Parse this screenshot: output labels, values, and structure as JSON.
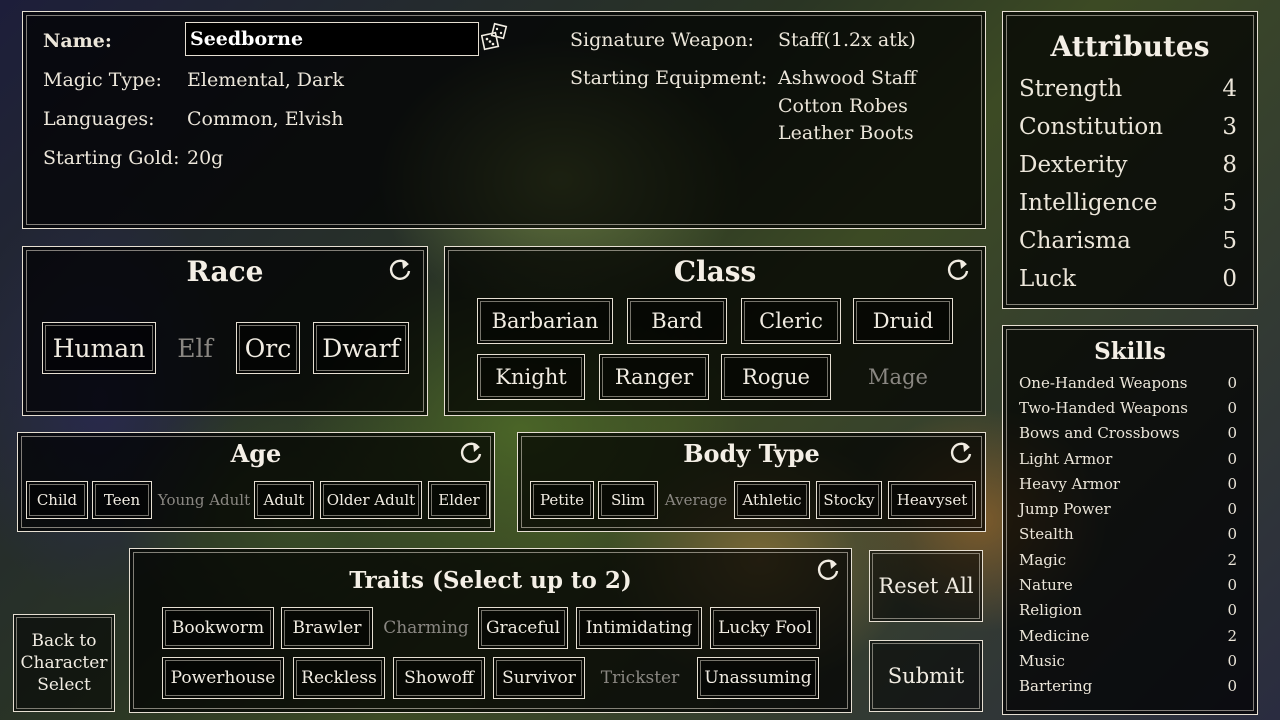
{
  "info": {
    "name_label": "Name:",
    "name_value": "Seedborne",
    "magic_label": "Magic Type:",
    "magic_value": "Elemental, Dark",
    "lang_label": "Languages:",
    "lang_value": "Common, Elvish",
    "gold_label": "Starting Gold:",
    "gold_value": "20g",
    "weapon_label": "Signature Weapon:",
    "weapon_value": "Staff(1.2x atk)",
    "equip_label": "Starting Equipment:",
    "equipment": [
      "Ashwood Staff",
      "Cotton Robes",
      "Leather Boots"
    ]
  },
  "race": {
    "title": "Race",
    "options": [
      "Human",
      "Elf",
      "Orc",
      "Dwarf"
    ],
    "selected": "Elf"
  },
  "class": {
    "title": "Class",
    "options": [
      "Barbarian",
      "Bard",
      "Cleric",
      "Druid",
      "Knight",
      "Ranger",
      "Rogue",
      "Mage"
    ],
    "selected": "Mage"
  },
  "age": {
    "title": "Age",
    "options": [
      "Child",
      "Teen",
      "Young Adult",
      "Adult",
      "Older Adult",
      "Elder"
    ],
    "selected": "Young Adult"
  },
  "body": {
    "title": "Body Type",
    "options": [
      "Petite",
      "Slim",
      "Average",
      "Athletic",
      "Stocky",
      "Heavyset"
    ],
    "selected": "Average"
  },
  "traits": {
    "title": "Traits (Select up to 2)",
    "options": [
      "Bookworm",
      "Brawler",
      "Charming",
      "Graceful",
      "Intimidating",
      "Lucky Fool",
      "Powerhouse",
      "Reckless",
      "Showoff",
      "Survivor",
      "Trickster",
      "Unassuming"
    ],
    "selected": [
      "Charming",
      "Trickster"
    ]
  },
  "attributes": {
    "title": "Attributes",
    "items": [
      {
        "name": "Strength",
        "value": "4"
      },
      {
        "name": "Constitution",
        "value": "3"
      },
      {
        "name": "Dexterity",
        "value": "8"
      },
      {
        "name": "Intelligence",
        "value": "5"
      },
      {
        "name": "Charisma",
        "value": "5"
      },
      {
        "name": "Luck",
        "value": "0"
      }
    ]
  },
  "skills": {
    "title": "Skills",
    "items": [
      {
        "name": "One-Handed Weapons",
        "value": "0"
      },
      {
        "name": "Two-Handed Weapons",
        "value": "0"
      },
      {
        "name": "Bows and Crossbows",
        "value": "0"
      },
      {
        "name": "Light Armor",
        "value": "0"
      },
      {
        "name": "Heavy Armor",
        "value": "0"
      },
      {
        "name": "Jump Power",
        "value": "0"
      },
      {
        "name": "Stealth",
        "value": "0"
      },
      {
        "name": "Magic",
        "value": "2"
      },
      {
        "name": "Nature",
        "value": "0"
      },
      {
        "name": "Religion",
        "value": "0"
      },
      {
        "name": "Medicine",
        "value": "2"
      },
      {
        "name": "Music",
        "value": "0"
      },
      {
        "name": "Bartering",
        "value": "0"
      }
    ]
  },
  "buttons": {
    "reset_all": "Reset All",
    "submit": "Submit",
    "back": "Back to Character Select"
  },
  "colors": {
    "border": "#e6dfd2",
    "dimmed": "#8a8782",
    "panel_bg": "rgba(0,0,0,0.72)"
  }
}
